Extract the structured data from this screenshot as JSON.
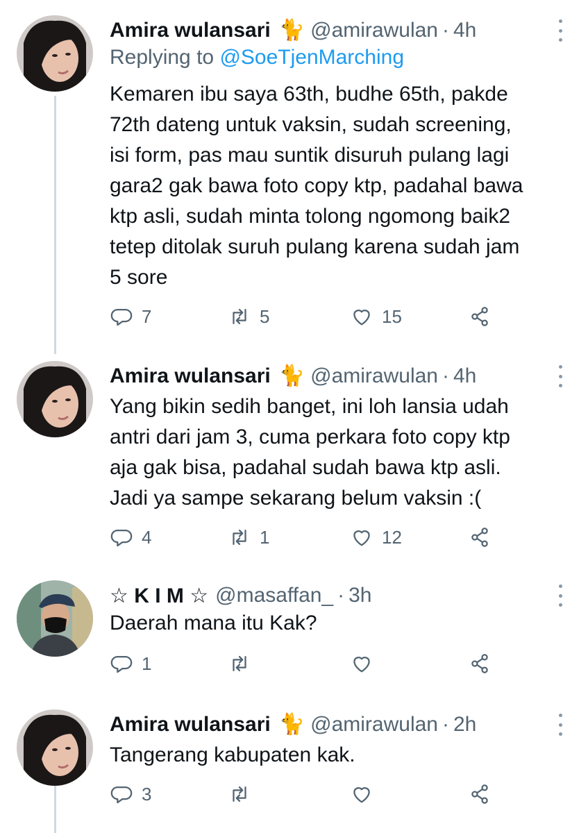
{
  "colors": {
    "text": "#0f1419",
    "secondary": "#536471",
    "link": "#1d9bf0",
    "thread_line": "#cfd9de"
  },
  "tweets": [
    {
      "name": "Amira wulansari",
      "emoji": "🐈",
      "handle": "@amirawulan",
      "separator": "·",
      "time": "4h",
      "replying_prefix": "Replying to",
      "replying_to": "@SoeTjenMarching",
      "text": "Kemaren ibu saya 63th, budhe 65th, pakde\n72th dateng untuk vaksin, sudah screening,\nisi form, pas mau suntik disuruh pulang lagi\ngara2 gak bawa foto copy ktp, padahal bawa\nktp asli, sudah minta tolong ngomong baik2\ntetep ditolak suruh pulang karena sudah jam\n5 sore",
      "replies": "7",
      "retweets": "5",
      "likes": "15"
    },
    {
      "name": "Amira wulansari",
      "emoji": "🐈",
      "handle": "@amirawulan",
      "separator": "·",
      "time": "4h",
      "text": "Yang bikin sedih banget, ini loh lansia udah\nantri dari jam 3, cuma perkara foto copy ktp\naja gak bisa, padahal sudah bawa ktp asli.\nJadi ya sampe sekarang belum vaksin :(",
      "replies": "4",
      "retweets": "1",
      "likes": "12"
    },
    {
      "name": "☆ K I M ☆",
      "handle": "@masaffan_",
      "separator": "·",
      "time": "3h",
      "text": "Daerah mana itu Kak?",
      "replies": "1",
      "retweets": "",
      "likes": ""
    },
    {
      "name": "Amira wulansari",
      "emoji": "🐈",
      "handle": "@amirawulan",
      "separator": "·",
      "time": "2h",
      "text": "Tangerang kabupaten kak.",
      "replies": "3",
      "retweets": "",
      "likes": ""
    }
  ]
}
